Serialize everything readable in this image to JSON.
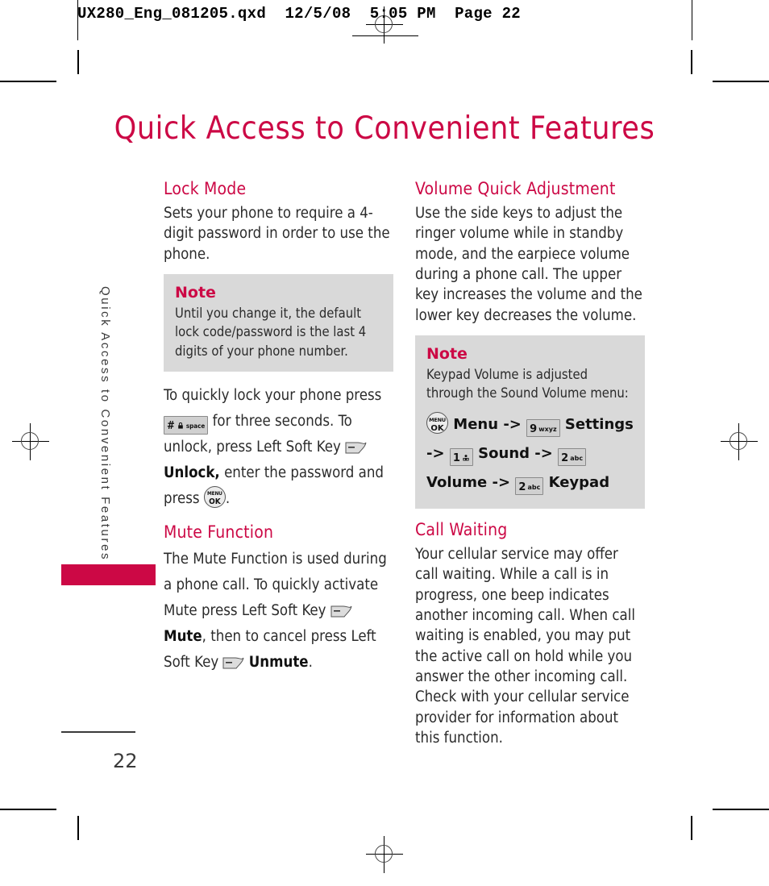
{
  "slug": {
    "text": "UX280_Eng_081205.qxd  12/5/08  5:05 PM  Page 22"
  },
  "page_title": "Quick Access to Convenient Features",
  "running_head": "Quick Access to Convenient Features",
  "page_number": "22",
  "colors": {
    "accent": "#cc0845",
    "note_bg": "#d9d9d9",
    "body_text": "#2b2b2b"
  },
  "left_column": {
    "lock_mode": {
      "heading": "Lock Mode",
      "paragraph": "Sets your phone to require a 4-digit password in order to use the phone.",
      "note": {
        "title": "Note",
        "body": "Until you change it, the default lock code/password is the last 4 digits of your phone number."
      },
      "instruction": {
        "part1": "To quickly lock your phone press",
        "key_hash_digit": "#",
        "key_hash_sub": "space",
        "part2": "for three seconds. To unlock, press Left Soft Key",
        "bold1": "Unlock,",
        "part3": "enter the password and press",
        "part4": "."
      }
    },
    "mute_function": {
      "heading": "Mute Function",
      "part1": "The Mute Function is used during a phone call. To quickly activate Mute press Left Soft Key",
      "bold1": "Mute",
      "part2": ", then to cancel press Left Soft Key",
      "bold2": "Unmute",
      "part3": "."
    }
  },
  "right_column": {
    "volume_quick_adjustment": {
      "heading": "Volume Quick Adjustment",
      "paragraph": "Use the side keys to adjust the ringer volume while in standby mode, and the earpiece volume during a phone call. The upper key increases the volume and the lower key decreases the volume.",
      "note": {
        "title": "Note",
        "body": "Keypad Volume is adjusted through the Sound Volume menu:",
        "steps": [
          {
            "key_type": "round",
            "key_top": "MENU",
            "key_bottom": "OK",
            "label": "Menu",
            "arrow": "->"
          },
          {
            "key_type": "rect",
            "key_digit": "9",
            "key_sub": "wxyz",
            "label": "Settings",
            "arrow": "->"
          },
          {
            "key_type": "rect",
            "key_digit": "1",
            "key_sub": "icon",
            "label": "Sound",
            "arrow": "->"
          },
          {
            "key_type": "rect",
            "key_digit": "2",
            "key_sub": "abc",
            "label": "Volume",
            "arrow": "->"
          },
          {
            "key_type": "rect",
            "key_digit": "2",
            "key_sub": "abc",
            "label": "Keypad",
            "arrow": ""
          }
        ]
      }
    },
    "call_waiting": {
      "heading": "Call Waiting",
      "paragraph": "Your cellular service may offer call waiting. While a call is in progress, one beep indicates another incoming call. When call waiting is enabled, you may put the active call on hold while you answer the other incoming call. Check with your cellular service provider for information about this function."
    }
  }
}
